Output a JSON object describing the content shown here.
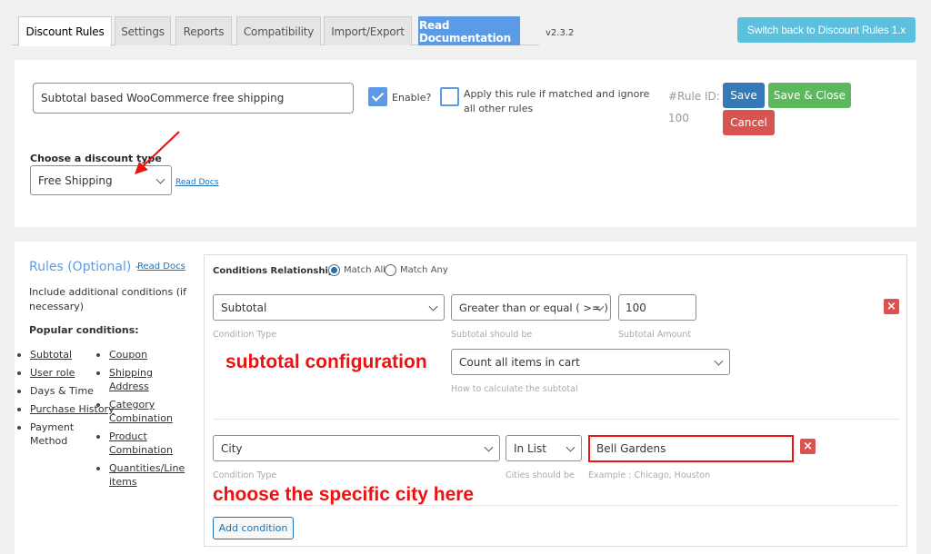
{
  "tabs": [
    {
      "label": "Discount Rules",
      "active": true
    },
    {
      "label": "Settings"
    },
    {
      "label": "Reports"
    },
    {
      "label": "Compatibility"
    },
    {
      "label": "Import/Export"
    },
    {
      "label": "Read Documentation"
    }
  ],
  "version": "v2.3.2",
  "switch_button": "Switch back to Discount Rules 1.x",
  "rule": {
    "title_value": "Subtotal based WooCommerce free shipping",
    "enable_label": "Enable?",
    "enable_checked": true,
    "apply_label": "Apply this rule if matched and ignore all other rules",
    "apply_checked": false,
    "rule_id_label": "#Rule ID:",
    "rule_id_value": "100",
    "save_label": "Save",
    "save_close_label": "Save & Close",
    "cancel_label": "Cancel",
    "discount_type_label": "Choose a discount type",
    "discount_type_value": "Free Shipping",
    "read_docs": "Read Docs"
  },
  "rules_section": {
    "title": "Rules (Optional)",
    "dash": "-",
    "read_docs": "Read Docs",
    "description": "Include additional conditions (if necessary)",
    "popular_label": "Popular conditions:",
    "popular_left": [
      {
        "label": "Subtotal",
        "link": true
      },
      {
        "label": "User role",
        "link": true
      },
      {
        "label": "Days & Time",
        "link": false
      },
      {
        "label": "Purchase History",
        "link": true
      },
      {
        "label": "Payment Method",
        "link": false
      }
    ],
    "popular_right": [
      {
        "label": "Coupon",
        "link": true
      },
      {
        "label": "Shipping Address",
        "link": true
      },
      {
        "label": "Category Combination",
        "link": true
      },
      {
        "label": "Product Combination",
        "link": true
      },
      {
        "label": "Quantities/Line items",
        "link": true
      }
    ]
  },
  "conditions": {
    "relationship_label": "Conditions Relationship",
    "match_all": "Match All",
    "match_any": "Match Any",
    "selected": "Match All",
    "subtotal_row": {
      "type_value": "Subtotal",
      "type_help": "Condition Type",
      "operator_value": "Greater than or equal ( >= )",
      "operator_help": "Subtotal should be",
      "amount_value": "100",
      "amount_help": "Subtotal Amount",
      "calc_value": "Count all items in cart",
      "calc_help": "How to calculate the subtotal"
    },
    "city_row": {
      "type_value": "City",
      "type_help": "Condition Type",
      "operator_value": "In List",
      "operator_help": "Cities should be",
      "cities_value": "Bell Gardens",
      "cities_help": "Example : Chicago, Houston"
    },
    "add_condition": "Add condition"
  },
  "annotations": {
    "subtotal": "subtotal configuration",
    "city": "choose the specific city here"
  },
  "colors": {
    "primary_blue": "#5b9be6",
    "save_blue": "#337ab7",
    "save_close_green": "#5cb85c",
    "cancel_red": "#d9534f",
    "switch_cyan": "#5bc0de",
    "annotation_red": "#ee1111"
  }
}
